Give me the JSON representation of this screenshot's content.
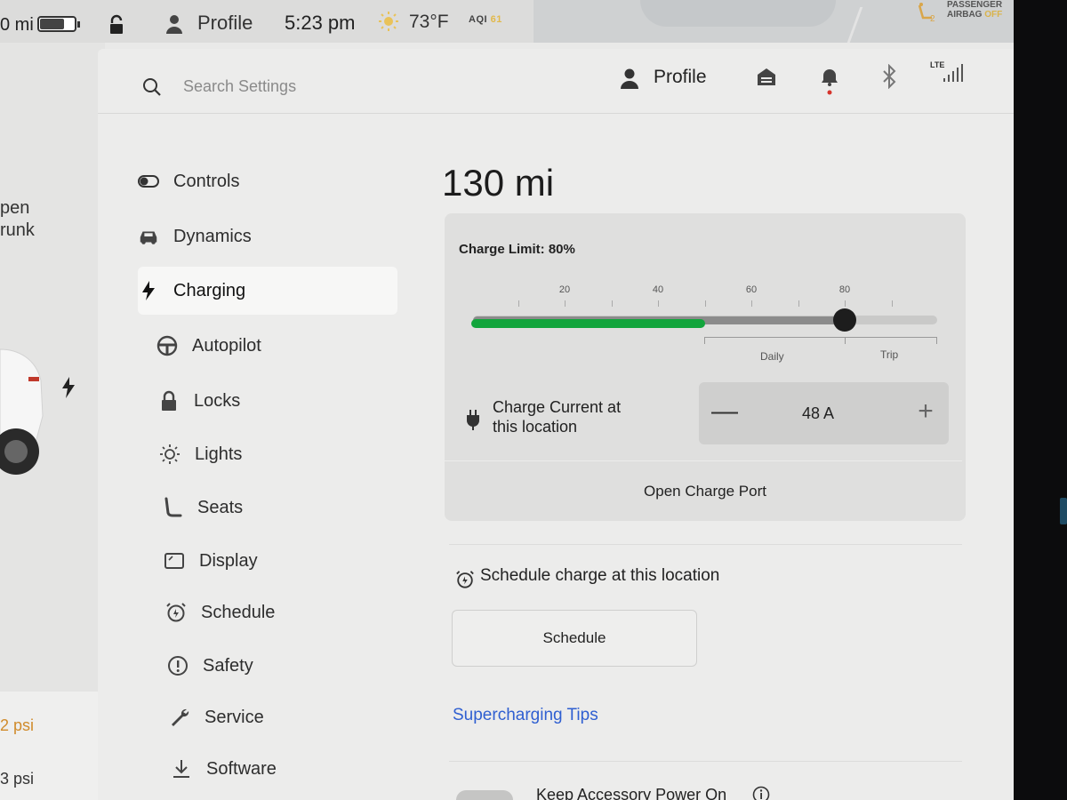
{
  "status_bar": {
    "range": "0 mi",
    "battery_level": 0.7,
    "profile": "Profile",
    "time": "5:23 pm",
    "temperature": "73°F",
    "aqi_label": "AQI",
    "aqi_value": "61",
    "airbag_line1": "PASSENGER",
    "airbag_line2": "AIRBAG",
    "airbag_state": "OFF"
  },
  "car_panel": {
    "trunk_line1": "pen",
    "trunk_line2": "runk",
    "tire_pressure_1": "2 psi",
    "tire_pressure_2": "3 psi"
  },
  "header": {
    "search_placeholder": "Search Settings",
    "profile": "Profile",
    "lte": "LTE"
  },
  "nav": {
    "items": [
      {
        "label": "Controls",
        "icon": "toggle-icon"
      },
      {
        "label": "Dynamics",
        "icon": "car-icon"
      },
      {
        "label": "Charging",
        "icon": "bolt-icon",
        "active": true
      },
      {
        "label": "Autopilot",
        "icon": "steering-wheel-icon"
      },
      {
        "label": "Locks",
        "icon": "lock-icon"
      },
      {
        "label": "Lights",
        "icon": "light-icon"
      },
      {
        "label": "Seats",
        "icon": "seat-icon"
      },
      {
        "label": "Display",
        "icon": "display-icon"
      },
      {
        "label": "Schedule",
        "icon": "alarm-clock-icon"
      },
      {
        "label": "Safety",
        "icon": "alert-circle-icon"
      },
      {
        "label": "Service",
        "icon": "wrench-icon"
      },
      {
        "label": "Software",
        "icon": "download-icon"
      }
    ]
  },
  "charging": {
    "range": "130 mi",
    "charge_limit_label": "Charge Limit: 80%",
    "charge_limit_value": 80,
    "current_charge_level": 50,
    "tick_labels": [
      "20",
      "40",
      "60",
      "80"
    ],
    "daily_label": "Daily",
    "trip_label": "Trip",
    "charge_current_label_1": "Charge Current at",
    "charge_current_label_2": "this location",
    "charge_current_value": "48  A",
    "minus": "—",
    "plus": "+",
    "open_charge_port": "Open Charge Port",
    "schedule_label": "Schedule charge at this location",
    "schedule_button": "Schedule",
    "supercharging_tips": "Supercharging Tips",
    "keep_accessory_power": "Keep Accessory Power On"
  },
  "colors": {
    "accent_green": "#12a53c",
    "link_blue": "#2f5fd1",
    "warning_orange": "#d08b2b"
  }
}
